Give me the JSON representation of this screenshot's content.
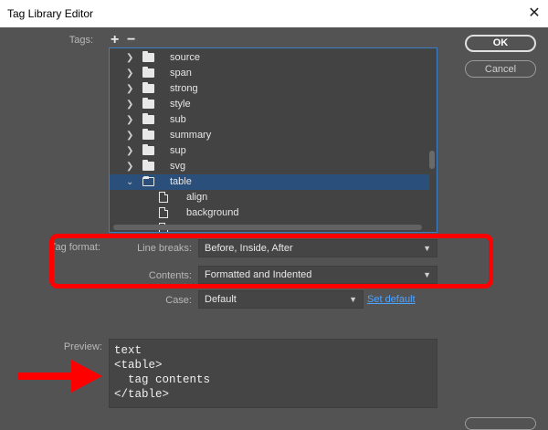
{
  "window": {
    "title": "Tag Library Editor",
    "close_glyph": "✕"
  },
  "tags": {
    "label": "Tags:",
    "add_glyph": "+",
    "remove_glyph": "−",
    "items": [
      {
        "name": "source",
        "kind": "folder",
        "expanded": false
      },
      {
        "name": "span",
        "kind": "folder",
        "expanded": false
      },
      {
        "name": "strong",
        "kind": "folder",
        "expanded": false
      },
      {
        "name": "style",
        "kind": "folder",
        "expanded": false
      },
      {
        "name": "sub",
        "kind": "folder",
        "expanded": false
      },
      {
        "name": "summary",
        "kind": "folder",
        "expanded": false
      },
      {
        "name": "sup",
        "kind": "folder",
        "expanded": false
      },
      {
        "name": "svg",
        "kind": "folder",
        "expanded": false
      },
      {
        "name": "table",
        "kind": "folder",
        "expanded": true,
        "selected": true
      },
      {
        "name": "align",
        "kind": "attribute"
      },
      {
        "name": "background",
        "kind": "attribute"
      }
    ]
  },
  "buttons": {
    "ok": "OK",
    "cancel": "Cancel"
  },
  "tag_format": {
    "label": "Tag format:",
    "line_breaks_label": "Line breaks:",
    "line_breaks_value": "Before, Inside, After",
    "contents_label": "Contents:",
    "contents_value": "Formatted and Indented",
    "case_label": "Case:",
    "case_value": "Default",
    "set_default": "Set default"
  },
  "preview": {
    "label": "Preview:",
    "lines": [
      "text",
      "<table>",
      "  tag contents",
      "</table>"
    ]
  },
  "colors": {
    "accent": "#3d7fc4",
    "highlight": "#ff0000",
    "link": "#4ea3ff",
    "selection": "#2a4f7a"
  },
  "icons": [
    "close-icon",
    "plus-icon",
    "minus-icon",
    "chevron-right-icon",
    "chevron-down-icon",
    "folder-icon",
    "file-icon",
    "dropdown-arrow-icon",
    "red-arrow-icon"
  ]
}
